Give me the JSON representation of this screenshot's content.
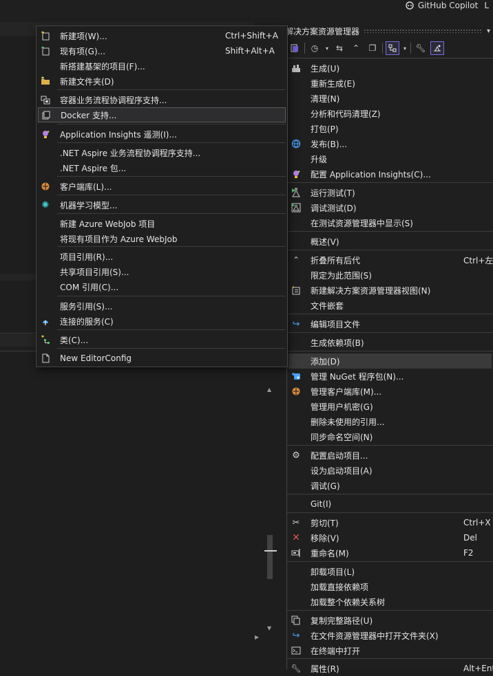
{
  "titlebar": {
    "copilot_label": "GitHub Copilot",
    "trailing": "L"
  },
  "solution_explorer": {
    "title": "解决方案资源管理器"
  },
  "context_menu": {
    "items": [
      {
        "label": "生成(U)",
        "shortcut": "",
        "icon": "build-icon"
      },
      {
        "label": "重新生成(E)",
        "shortcut": "",
        "icon": ""
      },
      {
        "label": "清理(N)",
        "shortcut": "",
        "icon": ""
      },
      {
        "label": "分析和代码清理(Z)",
        "shortcut": "",
        "icon": ""
      },
      {
        "label": "打包(P)",
        "shortcut": "",
        "icon": ""
      },
      {
        "label": "发布(B)...",
        "shortcut": "",
        "icon": "globe-icon"
      },
      {
        "label": "升级",
        "shortcut": "",
        "icon": ""
      },
      {
        "label": "配置 Application Insights(C)...",
        "shortcut": "",
        "icon": "bulb-icon"
      },
      {
        "label": "运行测试(T)",
        "shortcut": "",
        "icon": "flask-run-icon"
      },
      {
        "label": "调试测试(D)",
        "shortcut": "",
        "icon": "flask-debug-icon"
      },
      {
        "label": "在测试资源管理器中显示(S)",
        "shortcut": "",
        "icon": ""
      },
      {
        "label": "概述(V)",
        "shortcut": "",
        "icon": ""
      },
      {
        "label": "折叠所有后代",
        "shortcut": "Ctrl+左箭",
        "icon": "collapse-icon"
      },
      {
        "label": "限定为此范围(S)",
        "shortcut": "",
        "icon": ""
      },
      {
        "label": "新建解决方案资源管理器视图(N)",
        "shortcut": "",
        "icon": "new-view-icon"
      },
      {
        "label": "文件嵌套",
        "shortcut": "",
        "icon": ""
      },
      {
        "label": "编辑项目文件",
        "shortcut": "",
        "icon": "edit-arrow-icon"
      },
      {
        "label": "生成依赖项(B)",
        "shortcut": "",
        "icon": ""
      },
      {
        "label": "添加(D)",
        "shortcut": "",
        "icon": ""
      },
      {
        "label": "管理 NuGet 程序包(N)...",
        "shortcut": "",
        "icon": "nuget-icon"
      },
      {
        "label": "管理客户端库(M)...",
        "shortcut": "",
        "icon": "client-lib-icon"
      },
      {
        "label": "管理用户机密(G)",
        "shortcut": "",
        "icon": ""
      },
      {
        "label": "删除未使用的引用...",
        "shortcut": "",
        "icon": ""
      },
      {
        "label": "同步命名空间(N)",
        "shortcut": "",
        "icon": ""
      },
      {
        "label": "配置启动项目...",
        "shortcut": "",
        "icon": "gear-icon"
      },
      {
        "label": "设为启动项目(A)",
        "shortcut": "",
        "icon": ""
      },
      {
        "label": "调试(G)",
        "shortcut": "",
        "icon": ""
      },
      {
        "label": "Git(I)",
        "shortcut": "",
        "icon": ""
      },
      {
        "label": "剪切(T)",
        "shortcut": "Ctrl+X",
        "icon": "scissors-icon"
      },
      {
        "label": "移除(V)",
        "shortcut": "Del",
        "icon": "remove-x-icon"
      },
      {
        "label": "重命名(M)",
        "shortcut": "F2",
        "icon": "rename-icon"
      },
      {
        "label": "卸载项目(L)",
        "shortcut": "",
        "icon": ""
      },
      {
        "label": "加载直接依赖项",
        "shortcut": "",
        "icon": ""
      },
      {
        "label": "加载整个依赖关系树",
        "shortcut": "",
        "icon": ""
      },
      {
        "label": "复制完整路径(U)",
        "shortcut": "",
        "icon": "copy-icon"
      },
      {
        "label": "在文件资源管理器中打开文件夹(X)",
        "shortcut": "",
        "icon": "open-folder-icon"
      },
      {
        "label": "在终端中打开",
        "shortcut": "",
        "icon": "terminal-icon"
      },
      {
        "label": "属性(R)",
        "shortcut": "Alt+Ent",
        "icon": "wrench-icon"
      }
    ]
  },
  "add_submenu": {
    "items": [
      {
        "label": "新建项(W)...",
        "shortcut": "Ctrl+Shift+A",
        "icon": "new-item-icon"
      },
      {
        "label": "现有项(G)...",
        "shortcut": "Shift+Alt+A",
        "icon": "existing-item-icon"
      },
      {
        "label": "新搭建基架的项目(F)...",
        "shortcut": "",
        "icon": ""
      },
      {
        "label": "新建文件夹(D)",
        "shortcut": "",
        "icon": "new-folder-icon"
      },
      {
        "label": "容器业务流程协调程序支持...",
        "shortcut": "",
        "icon": "container-icon"
      },
      {
        "label": "Docker 支持...",
        "shortcut": "",
        "icon": "docker-icon"
      },
      {
        "label": "Application Insights 遥测(I)...",
        "shortcut": "",
        "icon": "bulb-icon"
      },
      {
        "label": ".NET Aspire 业务流程协调程序支持...",
        "shortcut": "",
        "icon": ""
      },
      {
        "label": ".NET Aspire 包...",
        "shortcut": "",
        "icon": ""
      },
      {
        "label": "客户端库(L)...",
        "shortcut": "",
        "icon": "client-lib-icon"
      },
      {
        "label": "机器学习模型...",
        "shortcut": "",
        "icon": "ml-model-icon"
      },
      {
        "label": "新建 Azure WebJob 项目",
        "shortcut": "",
        "icon": ""
      },
      {
        "label": "将现有项目作为 Azure WebJob",
        "shortcut": "",
        "icon": ""
      },
      {
        "label": "项目引用(R)...",
        "shortcut": "",
        "icon": ""
      },
      {
        "label": "共享项目引用(S)...",
        "shortcut": "",
        "icon": ""
      },
      {
        "label": "COM 引用(C)...",
        "shortcut": "",
        "icon": ""
      },
      {
        "label": "服务引用(S)...",
        "shortcut": "",
        "icon": ""
      },
      {
        "label": "连接的服务(C)",
        "shortcut": "",
        "icon": "connected-service-icon"
      },
      {
        "label": "类(C)...",
        "shortcut": "",
        "icon": "class-icon"
      },
      {
        "label": "New EditorConfig",
        "shortcut": "",
        "icon": "file-icon"
      }
    ]
  },
  "colors": {
    "accent": "#7b6cd9",
    "menu_bg": "#1f1f1f",
    "border": "#454545",
    "highlight": "#3a3a3a"
  }
}
